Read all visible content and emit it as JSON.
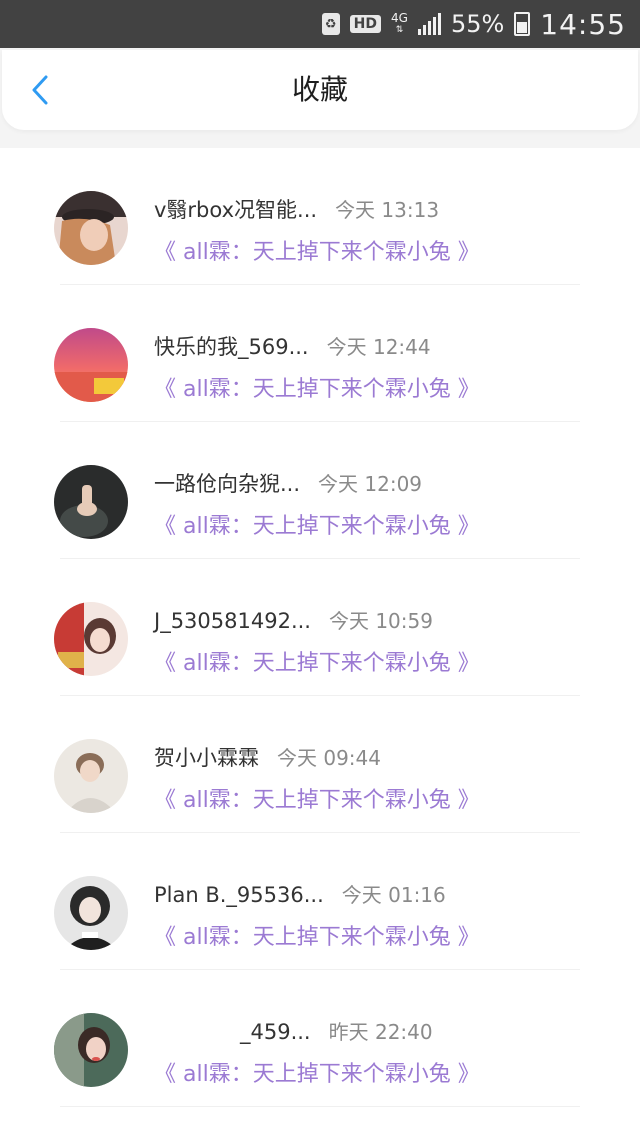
{
  "status_bar": {
    "network": "4G",
    "hd": "HD",
    "battery_percent": "55%",
    "time": "14:55"
  },
  "header": {
    "title": "收藏",
    "back_icon": "chevron-left-icon"
  },
  "colors": {
    "accent_blue": "#2f9bf2",
    "quote_purple": "#9b7ad3",
    "status_bar_bg": "#424242"
  },
  "items": [
    {
      "name": "v翳rbox况智能...",
      "time": "今天 13:13",
      "quote": "《 all霖：天上掉下来个霖小兔 》"
    },
    {
      "name": "快乐的我_569...",
      "time": "今天 12:44",
      "quote": "《 all霖：天上掉下来个霖小兔 》"
    },
    {
      "name": "一路伧向杂猊...",
      "time": "今天 12:09",
      "quote": "《 all霖：天上掉下来个霖小兔 》"
    },
    {
      "name": "J_530581492...",
      "time": "今天 10:59",
      "quote": "《 all霖：天上掉下来个霖小兔 》"
    },
    {
      "name": "贺小小霖霖",
      "time": "今天 09:44",
      "quote": "《 all霖：天上掉下来个霖小兔 》"
    },
    {
      "name": "Plan B._95536...",
      "time": "今天 01:16",
      "quote": "《 all霖：天上掉下来个霖小兔 》"
    },
    {
      "name": "_459...",
      "time": "昨天 22:40",
      "quote": "《 all霖：天上掉下来个霖小兔 》"
    }
  ]
}
